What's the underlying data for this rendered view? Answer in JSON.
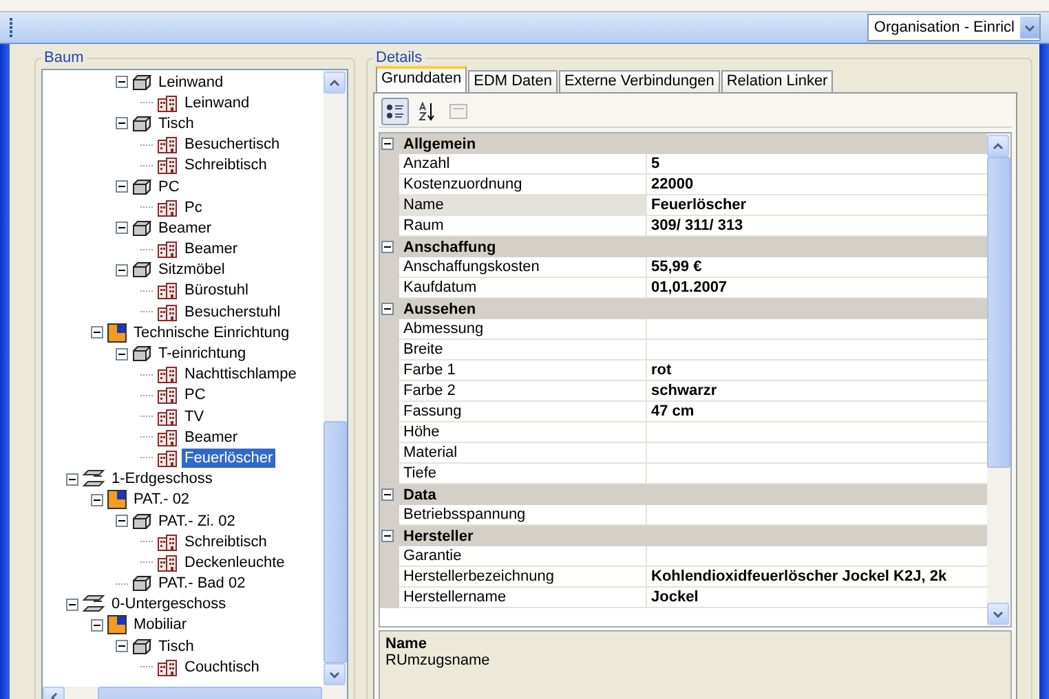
{
  "toolbar": {
    "combo": {
      "value": "Organisation - Einricl"
    }
  },
  "tree": {
    "title": "Baum",
    "nodes": [
      {
        "children": [
          {
            "children": [
              {
                "kind": "category",
                "label": "Leinwand",
                "expanded": true,
                "selected": false,
                "children": [
                  {
                    "kind": "item",
                    "label": "Leinwand",
                    "selected": false
                  }
                ]
              },
              {
                "kind": "category",
                "label": "Tisch",
                "expanded": true,
                "selected": false,
                "children": [
                  {
                    "kind": "item",
                    "label": "Besuchertisch",
                    "selected": false
                  },
                  {
                    "kind": "item",
                    "label": "Schreibtisch",
                    "selected": false
                  }
                ]
              },
              {
                "kind": "category",
                "label": "PC",
                "expanded": true,
                "selected": false,
                "children": [
                  {
                    "kind": "item",
                    "label": "Pc",
                    "selected": false
                  }
                ]
              },
              {
                "kind": "category",
                "label": "Beamer",
                "expanded": true,
                "selected": false,
                "children": [
                  {
                    "kind": "item",
                    "label": "Beamer",
                    "selected": false
                  }
                ]
              },
              {
                "kind": "category",
                "label": "Sitzmöbel",
                "expanded": true,
                "selected": false,
                "children": [
                  {
                    "kind": "item",
                    "label": "Bürostuhl",
                    "selected": false
                  },
                  {
                    "kind": "item",
                    "label": "Besucherstuhl",
                    "selected": false
                  }
                ]
              }
            ]
          },
          {
            "kind": "room",
            "label": "Technische Einrichtung",
            "expanded": true,
            "selected": false,
            "children": [
              {
                "kind": "category",
                "label": "T-einrichtung",
                "expanded": true,
                "selected": false,
                "children": [
                  {
                    "kind": "item",
                    "label": "Nachttischlampe",
                    "selected": false
                  },
                  {
                    "kind": "item",
                    "label": "PC",
                    "selected": false
                  },
                  {
                    "kind": "item",
                    "label": "TV",
                    "selected": false
                  },
                  {
                    "kind": "item",
                    "label": "Beamer",
                    "selected": false
                  },
                  {
                    "kind": "item",
                    "label": "Feuerlöscher",
                    "selected": true
                  }
                ]
              }
            ]
          }
        ]
      },
      {
        "kind": "floor",
        "label": "1-Erdgeschoss",
        "expanded": true,
        "selected": false,
        "children": [
          {
            "kind": "room",
            "label": "PAT.- 02",
            "expanded": true,
            "selected": false,
            "children": [
              {
                "kind": "category",
                "label": "PAT.- Zi. 02",
                "expanded": true,
                "selected": false,
                "children": [
                  {
                    "kind": "item",
                    "label": "Schreibtisch",
                    "selected": false
                  },
                  {
                    "kind": "item",
                    "label": "Deckenleuchte",
                    "selected": false
                  }
                ]
              },
              {
                "kind": "category",
                "label": "PAT.- Bad 02",
                "selected": false
              }
            ]
          }
        ]
      },
      {
        "kind": "floor",
        "label": "0-Untergeschoss",
        "expanded": true,
        "selected": false,
        "children": [
          {
            "kind": "room",
            "label": "Mobiliar",
            "expanded": true,
            "selected": false,
            "children": [
              {
                "kind": "category",
                "label": "Tisch",
                "expanded": true,
                "selected": false,
                "children": [
                  {
                    "kind": "item",
                    "label": "Couchtisch",
                    "selected": false
                  }
                ]
              }
            ]
          }
        ]
      }
    ]
  },
  "details": {
    "title": "Details",
    "tabs": [
      {
        "label": "Grunddaten",
        "selected": true
      },
      {
        "label": "EDM Daten",
        "selected": false
      },
      {
        "label": "Externe Verbindungen",
        "selected": false
      },
      {
        "label": "Relation Linker",
        "selected": false
      }
    ],
    "grid_toolbar": [
      {
        "kind": "categorized",
        "selected": true,
        "disabled": false
      },
      {
        "kind": "alphabetical",
        "selected": false,
        "disabled": false
      },
      {
        "kind": "pages",
        "selected": false,
        "disabled": true
      }
    ],
    "categories": [
      {
        "label": "Allgemein",
        "expanded": true,
        "rows": [
          {
            "name": "Anzahl",
            "value": "5",
            "selected": false
          },
          {
            "name": "Kostenzuordnung",
            "value": "22000",
            "selected": false
          },
          {
            "name": "Name",
            "value": "Feuerlöscher",
            "selected": true
          },
          {
            "name": "Raum",
            "value": "309/ 311/ 313",
            "selected": false
          }
        ]
      },
      {
        "label": "Anschaffung",
        "expanded": true,
        "rows": [
          {
            "name": "Anschaffungskosten",
            "value": "55,99 €",
            "selected": false
          },
          {
            "name": "Kaufdatum",
            "value": "01,01.2007",
            "selected": false
          }
        ]
      },
      {
        "label": "Aussehen",
        "expanded": true,
        "rows": [
          {
            "name": "Abmessung",
            "selected": false
          },
          {
            "name": "Breite",
            "selected": false
          },
          {
            "name": "Farbe 1",
            "value": "rot",
            "selected": false
          },
          {
            "name": "Farbe 2",
            "value": "schwarzr",
            "selected": false
          },
          {
            "name": "Fassung",
            "value": "47 cm",
            "selected": false
          },
          {
            "name": "Höhe",
            "selected": false
          },
          {
            "name": "Material",
            "selected": false
          },
          {
            "name": "Tiefe",
            "selected": false
          }
        ]
      },
      {
        "label": "Data",
        "expanded": true,
        "rows": [
          {
            "name": "Betriebsspannung",
            "selected": false
          }
        ]
      },
      {
        "label": "Hersteller",
        "expanded": true,
        "rows": [
          {
            "name": "Garantie",
            "selected": false
          },
          {
            "name": "Herstellerbezeichnung",
            "value": "Kohlendioxidfeuerlöscher Jockel K2J, 2k",
            "selected": false
          },
          {
            "name": "Herstellername",
            "value": "Jockel",
            "selected": false
          }
        ]
      }
    ],
    "description": {
      "title": "Name",
      "text": "RUmzugsname"
    }
  }
}
